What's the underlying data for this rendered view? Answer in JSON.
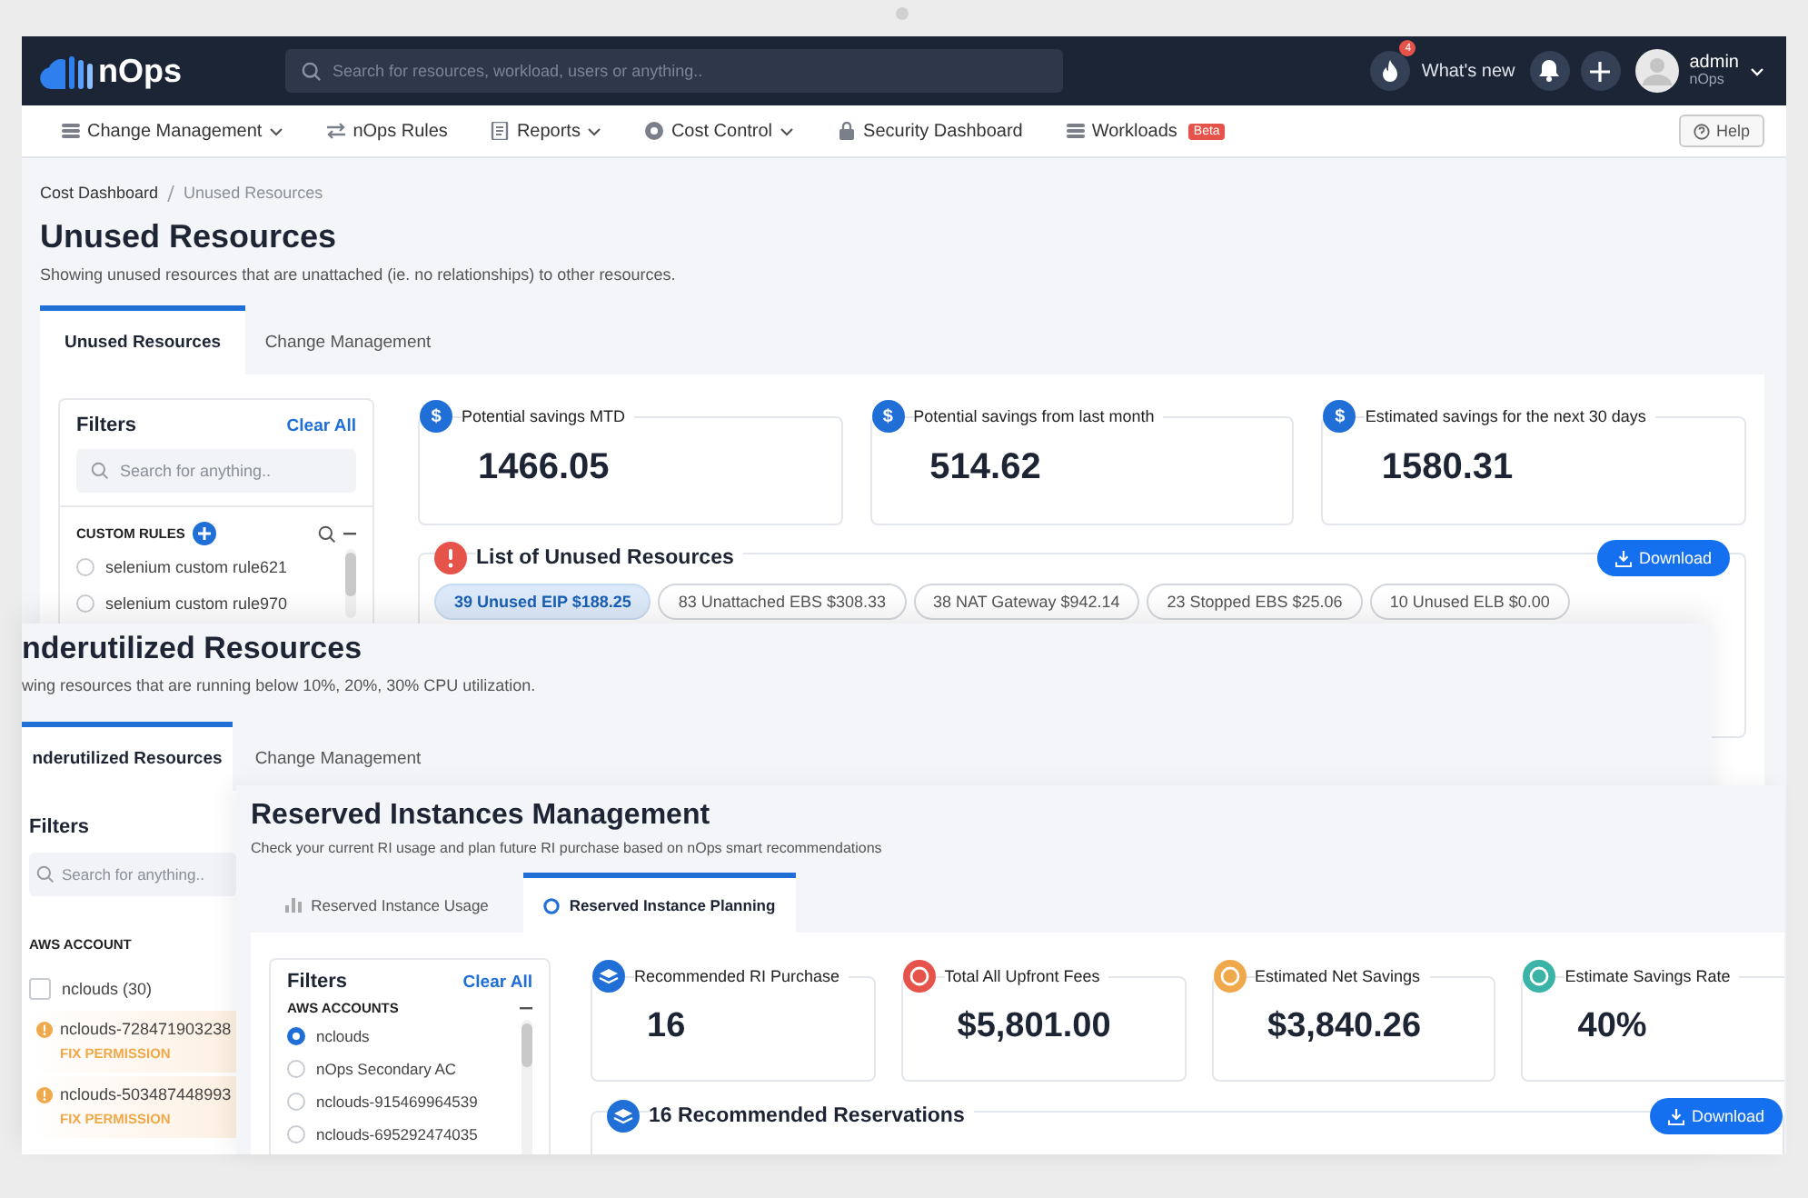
{
  "top_bar": {
    "logo": "nOps",
    "search": {
      "placeholder": "Search for resources, workload, users or anything.."
    },
    "notification_count": "4",
    "whats_new": "What's new",
    "user": {
      "name": "admin",
      "org": "nOps"
    }
  },
  "nav": {
    "items": [
      {
        "label": "Change Management",
        "dropdown": true
      },
      {
        "label": "nOps Rules",
        "dropdown": false
      },
      {
        "label": "Reports",
        "dropdown": true
      },
      {
        "label": "Cost Control",
        "dropdown": true
      },
      {
        "label": "Security Dashboard",
        "dropdown": false
      },
      {
        "label": "Workloads",
        "dropdown": false,
        "badge": "Beta"
      }
    ],
    "help": "Help"
  },
  "unused_view": {
    "breadcrumb": [
      "Cost Dashboard",
      "Unused Resources"
    ],
    "title": "Unused Resources",
    "subtitle": "Showing unused resources that are unattached (ie. no relationships) to other resources.",
    "tabs": [
      {
        "label": "Unused Resources",
        "selected": true
      },
      {
        "label": "Change Management",
        "selected": false
      }
    ],
    "filters": {
      "title": "Filters",
      "clear": "Clear All",
      "search_placeholder": "Search for anything..",
      "section": "CUSTOM RULES",
      "rules": [
        {
          "label": "selenium custom rule621",
          "selected": false
        },
        {
          "label": "selenium custom rule970",
          "selected": false
        }
      ]
    },
    "cards": [
      {
        "symbol": "$",
        "label": "Potential savings MTD",
        "value": "1466.05"
      },
      {
        "symbol": "$",
        "label": "Potential savings from last month",
        "value": "514.62"
      },
      {
        "symbol": "$",
        "label": "Estimated savings for the next 30 days",
        "value": "1580.31"
      }
    ],
    "list": {
      "title": "List of Unused Resources",
      "download": "Download",
      "chips": [
        {
          "label": "39 Unused EIP $188.25",
          "selected": true
        },
        {
          "label": "83 Unattached EBS $308.33",
          "selected": false
        },
        {
          "label": "38 NAT Gateway $942.14",
          "selected": false
        },
        {
          "label": "23 Stopped EBS $25.06",
          "selected": false
        },
        {
          "label": "10 Unused ELB $0.00",
          "selected": false
        }
      ]
    }
  },
  "underutilized_view": {
    "title": "nderutilized Resources",
    "subtitle": "wing resources that are running below 10%, 20%, 30% CPU utilization.",
    "tabs": [
      {
        "label": "nderutilized Resources",
        "selected": true
      },
      {
        "label": "Change Management",
        "selected": false
      }
    ],
    "filters": {
      "title": "Filters",
      "search_placeholder": "Search for anything..",
      "section": "AWS ACCOUNT",
      "accounts": [
        {
          "kind": "checkbox",
          "label": "nclouds (30)",
          "checked": false
        },
        {
          "kind": "warning",
          "label": "nclouds-728471903238",
          "action": "FIX PERMISSION"
        },
        {
          "kind": "warning",
          "label": "nclouds-503487448993",
          "action": "FIX PERMISSION"
        }
      ]
    }
  },
  "ri_view": {
    "title": "Reserved Instances Management",
    "subtitle": "Check your current RI usage and plan future RI purchase based on nOps smart recommendations",
    "tabs": [
      {
        "label": "Reserved Instance Usage",
        "selected": false
      },
      {
        "label": "Reserved Instance Planning",
        "selected": true
      }
    ],
    "filters": {
      "title": "Filters",
      "clear": "Clear All",
      "section": "AWS ACCOUNTS",
      "accounts": [
        {
          "label": "nclouds",
          "selected": true
        },
        {
          "label": "nOps Secondary AC",
          "selected": false
        },
        {
          "label": "nclouds-915469964539",
          "selected": false
        },
        {
          "label": "nclouds-695292474035",
          "selected": false
        }
      ]
    },
    "cards": [
      {
        "label": "Recommended RI Purchase",
        "value": "16",
        "color": "#1f6fd6"
      },
      {
        "label": "Total All Upfront Fees",
        "value": "$5,801.00",
        "color": "#e5534b"
      },
      {
        "label": "Estimated Net Savings",
        "value": "$3,840.26",
        "color": "#f0a94a"
      },
      {
        "label": "Estimate Savings Rate",
        "value": "40%",
        "color": "#3bb3a6"
      }
    ],
    "reservations": {
      "title": "16 Recommended Reservations",
      "download": "Download"
    }
  }
}
